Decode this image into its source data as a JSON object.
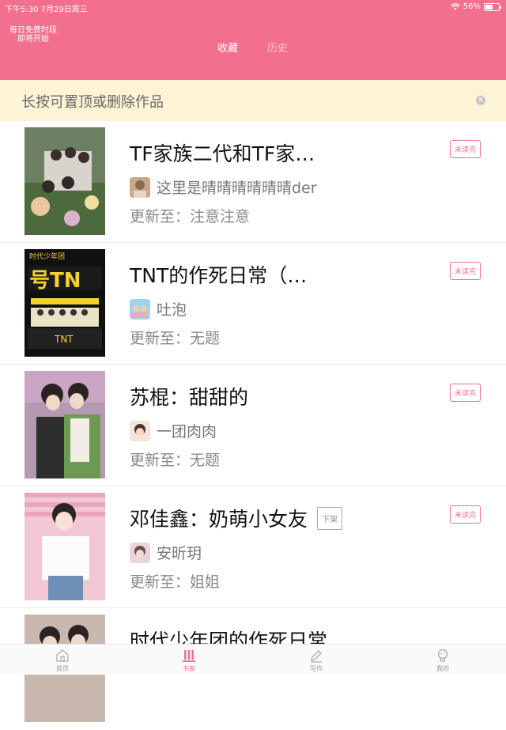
{
  "status_bar": {
    "time_date": "下午5:30   7月29日周三",
    "battery": "56%",
    "battery_level": 0.56
  },
  "header": {
    "promo_line1": "每日免费时段",
    "promo_line2": "即将开始",
    "tabs": [
      {
        "label": "收藏",
        "active": true
      },
      {
        "label": "历史",
        "active": false
      }
    ]
  },
  "notice": {
    "text": "长按可置顶或删除作品",
    "close_icon": "close-circle-icon"
  },
  "books": [
    {
      "title": "TF家族二代和TF家…",
      "author": "这里是晴晴晴晴晴晴der",
      "update": "更新至：注意注意",
      "badge": "未读完",
      "tag": ""
    },
    {
      "title": "TNT的作死日常（…",
      "author": "吐泡",
      "update": "更新至：无题",
      "badge": "未读完",
      "tag": ""
    },
    {
      "title": "苏棍：甜甜的",
      "author": "一团肉肉",
      "update": "更新至：无题",
      "badge": "未读完",
      "tag": ""
    },
    {
      "title": "邓佳鑫：奶萌小女友",
      "author": "安昕玥",
      "update": "更新至：姐姐",
      "badge": "未读完",
      "tag": "下架"
    },
    {
      "title": "时代少年团的作死日常",
      "author": "",
      "update": "",
      "badge": "",
      "tag": ""
    }
  ],
  "tabbar": [
    {
      "label": "首页",
      "icon": "home-icon",
      "active": false
    },
    {
      "label": "书架",
      "icon": "bookshelf-icon",
      "active": true
    },
    {
      "label": "写作",
      "icon": "pen-icon",
      "active": false
    },
    {
      "label": "我的",
      "icon": "profile-icon",
      "active": false
    }
  ],
  "colors": {
    "accent": "#f2708e",
    "notice_bg": "#fdf3d5"
  }
}
